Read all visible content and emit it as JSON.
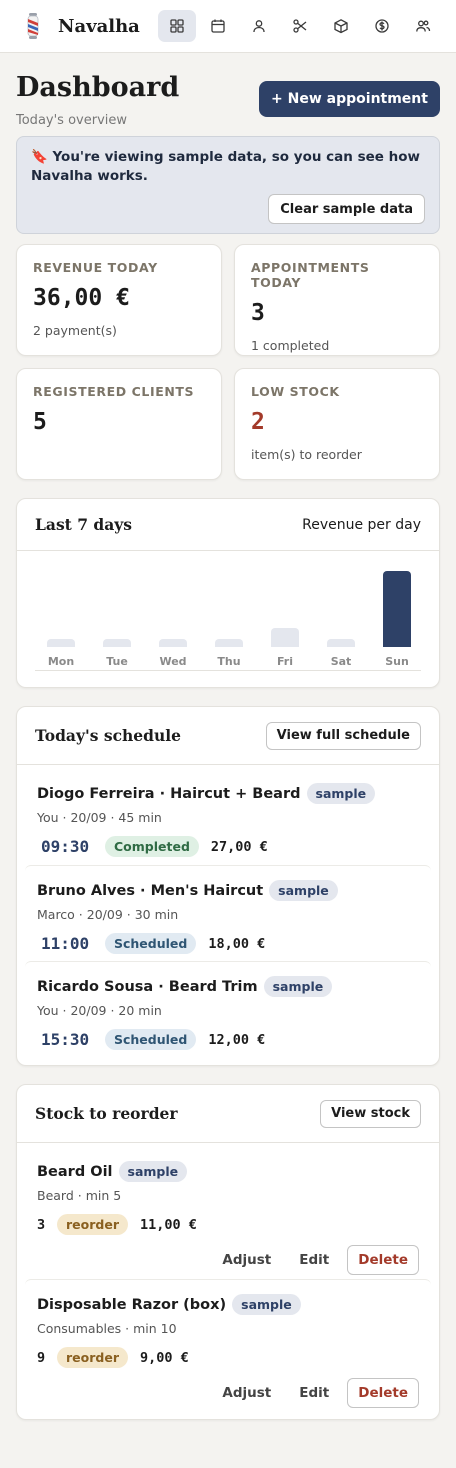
{
  "app": {
    "name": "Navalha"
  },
  "nav": {
    "items": [
      {
        "icon": "dashboard-grid-icon"
      },
      {
        "icon": "calendar-icon"
      },
      {
        "icon": "user-icon"
      },
      {
        "icon": "scissors-icon"
      },
      {
        "icon": "box-icon"
      },
      {
        "icon": "dollar-icon"
      },
      {
        "icon": "users-icon"
      }
    ]
  },
  "header": {
    "title": "Dashboard",
    "subtitle": "Today's overview",
    "new_button": "+ New appointment"
  },
  "banner": {
    "text": "🔖 You're viewing sample data, so you can see how Navalha works.",
    "button": "Clear sample data"
  },
  "stats": [
    {
      "label": "REVENUE TODAY",
      "value": "36,00 €",
      "sub": "2 payment(s)"
    },
    {
      "label": "APPOINTMENTS TODAY",
      "value": "3",
      "sub": "1 completed"
    },
    {
      "label": "REGISTERED CLIENTS",
      "value": "5",
      "sub": ""
    },
    {
      "label": "LOW STOCK",
      "value": "2",
      "sub": "item(s) to reorder"
    }
  ],
  "revenue_chart": {
    "title": "Last 7 days",
    "right_label": "Revenue per day"
  },
  "chart_data": {
    "type": "bar",
    "categories": [
      "Mon",
      "Tue",
      "Wed",
      "Thu",
      "Fri",
      "Sat",
      "Sun"
    ],
    "values": [
      0,
      0,
      0,
      0,
      9,
      0,
      36
    ],
    "ylim": [
      0,
      36
    ]
  },
  "schedule": {
    "title": "Today's schedule",
    "button": "View full schedule",
    "items": [
      {
        "title": "Diogo Ferreira · Haircut + Beard",
        "tag": "sample",
        "sub": "You · 20/09 · 45 min",
        "time": "09:30",
        "status": "Completed",
        "price": "27,00 €"
      },
      {
        "title": "Bruno Alves · Men's Haircut",
        "tag": "sample",
        "sub": "Marco · 20/09 · 30 min",
        "time": "11:00",
        "status": "Scheduled",
        "price": "18,00 €"
      },
      {
        "title": "Ricardo Sousa · Beard Trim",
        "tag": "sample",
        "sub": "You · 20/09 · 20 min",
        "time": "15:30",
        "status": "Scheduled",
        "price": "12,00 €"
      }
    ]
  },
  "stock": {
    "title": "Stock to reorder",
    "button": "View stock",
    "items": [
      {
        "title": "Beard Oil",
        "tag": "sample",
        "sub": "Beard · min 5",
        "qty": "3",
        "status": "reorder",
        "price": "11,00 €",
        "adjust": "Adjust",
        "edit": "Edit",
        "delete": "Delete"
      },
      {
        "title": "Disposable Razor (box)",
        "tag": "sample",
        "sub": "Consumables · min 10",
        "qty": "9",
        "status": "reorder",
        "price": "9,00 €",
        "adjust": "Adjust",
        "edit": "Edit",
        "delete": "Delete"
      }
    ]
  }
}
